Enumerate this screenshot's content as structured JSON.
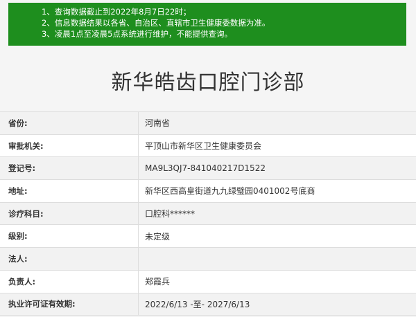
{
  "notice": {
    "lines": [
      "1、查询数据截止到2022年8月7日22时；",
      "2、信息数据结果以各省、自治区、直辖市卫生健康委数据为准。",
      "3、凌晨1点至凌晨5点系统进行维护，不能提供查询。"
    ]
  },
  "title": "新华皓齿口腔门诊部",
  "rows": [
    {
      "label": "省份:",
      "value": "河南省"
    },
    {
      "label": "审批机关:",
      "value": "平顶山市新华区卫生健康委员会"
    },
    {
      "label": "登记号:",
      "value": "MA9L3QJ7-841040217D1522"
    },
    {
      "label": "地址:",
      "value": "新华区西高皇街道九九绿璧园0401002号底商"
    },
    {
      "label": "诊疗科目:",
      "value": "口腔科******"
    },
    {
      "label": "级别:",
      "value": "未定级"
    },
    {
      "label": "法人:",
      "value": ""
    },
    {
      "label": "负责人:",
      "value": "郑霞兵"
    },
    {
      "label": "执业许可证有效期:",
      "value": "2022/6/13 -至- 2027/6/13"
    }
  ]
}
